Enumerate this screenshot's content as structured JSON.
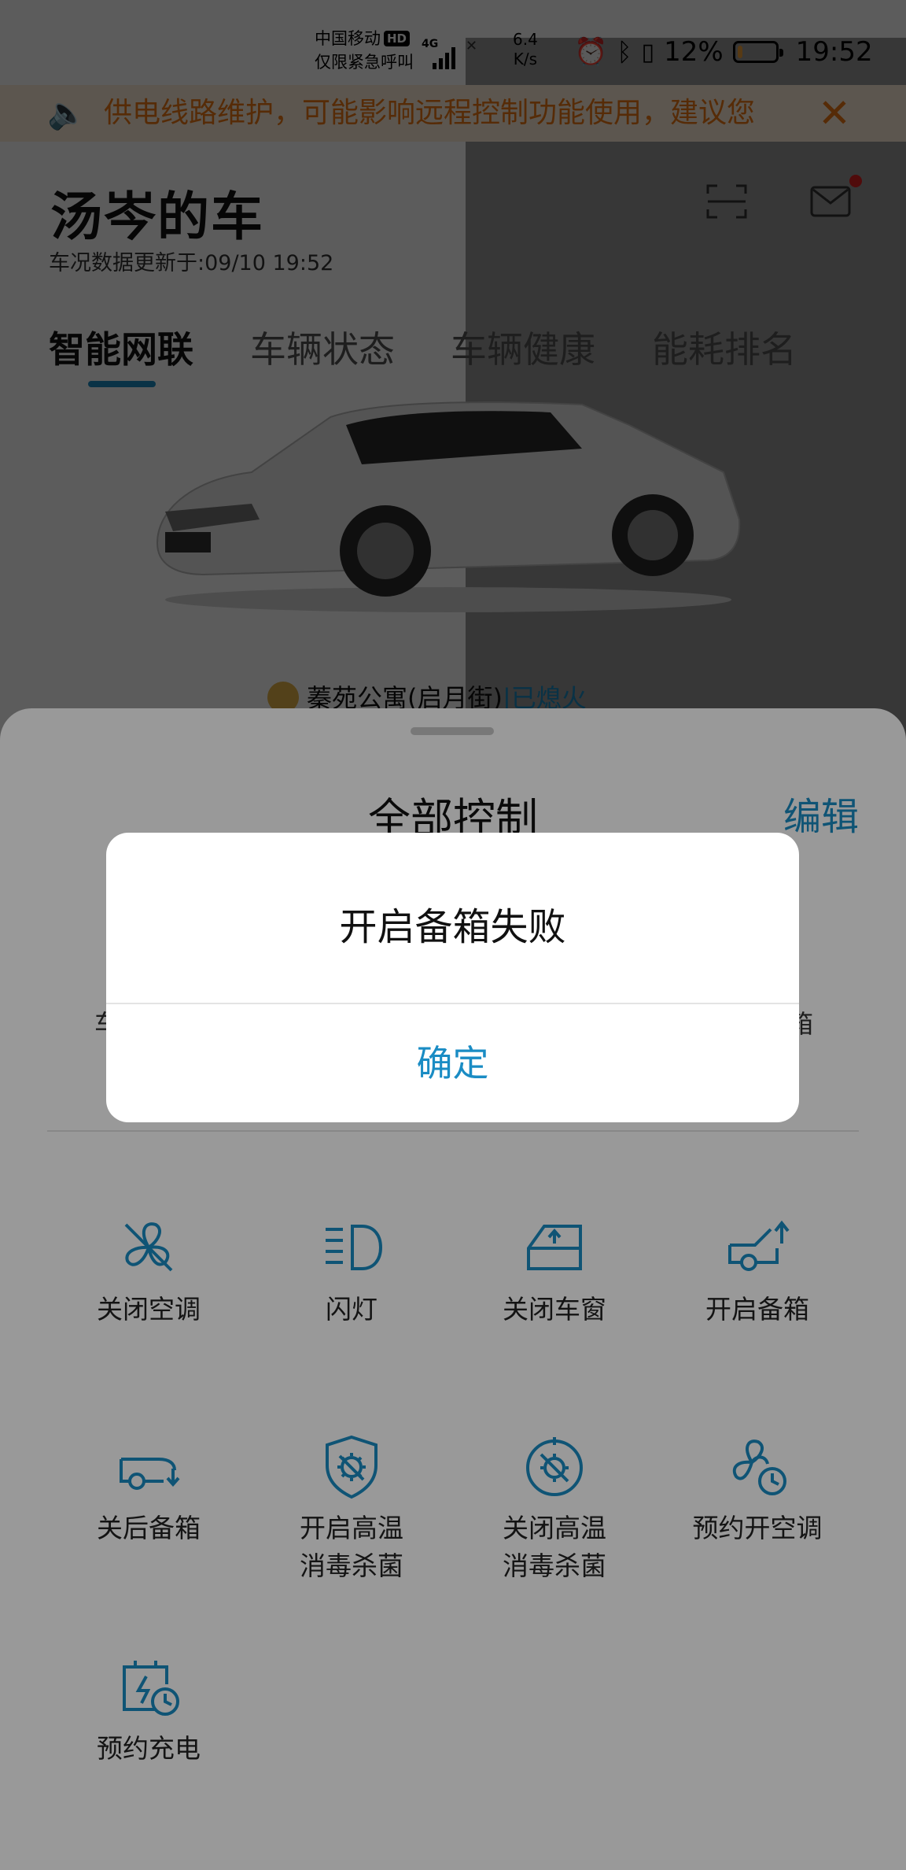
{
  "status_bar": {
    "carrier": "中国移动",
    "hd": "HD",
    "emergency": "仅限紧急呼叫",
    "network": "4G",
    "speed_value": "6.4",
    "speed_unit": "K/s",
    "battery_percent": "12%",
    "battery_level": 0.12,
    "time": "19:52",
    "icons": [
      "alarm-icon",
      "bluetooth-icon",
      "vibrate-icon"
    ]
  },
  "notice": {
    "text": "供电线路维护，可能影响远程控制功能使用，建议您",
    "icon": "speaker-icon",
    "close_icon": "close-icon"
  },
  "header": {
    "title": "汤岑的车",
    "update_time": "车况数据更新于:09/10 19:52"
  },
  "tabs": [
    {
      "label": "智能网联",
      "active": true
    },
    {
      "label": "车辆状态",
      "active": false
    },
    {
      "label": "车辆健康",
      "active": false
    },
    {
      "label": "能耗排名",
      "active": false
    }
  ],
  "location": {
    "name": "蓁苑公寓(启月街)",
    "separator": "|",
    "status": "已熄火"
  },
  "sheet": {
    "title": "全部控制",
    "edit": "编辑",
    "peek_left": "车",
    "peek_right": "箱",
    "controls": [
      {
        "label": "关闭空调",
        "icon": "fan-off-icon"
      },
      {
        "label": "闪灯",
        "icon": "headlight-icon"
      },
      {
        "label": "关闭车窗",
        "icon": "car-window-icon"
      },
      {
        "label": "开启备箱",
        "icon": "trunk-open-icon"
      },
      {
        "label": "关后备箱",
        "icon": "trunk-close-icon"
      },
      {
        "label": "开启高温\n消毒杀菌",
        "line1": "开启高温",
        "line2": "消毒杀菌",
        "icon": "shield-sterilize-icon"
      },
      {
        "label": "关闭高温\n消毒杀菌",
        "line1": "关闭高温",
        "line2": "消毒杀菌",
        "icon": "sterilize-off-icon"
      },
      {
        "label": "预约开空调",
        "icon": "fan-clock-icon"
      },
      {
        "label": "预约充电",
        "icon": "charge-clock-icon"
      }
    ]
  },
  "dialog": {
    "message": "开启备箱失败",
    "confirm": "确定"
  },
  "colors": {
    "accent": "#1a8cc4",
    "notice_text": "#ee7b14",
    "notice_bg": "#fff1dd",
    "mail_dot": "#e02020"
  }
}
